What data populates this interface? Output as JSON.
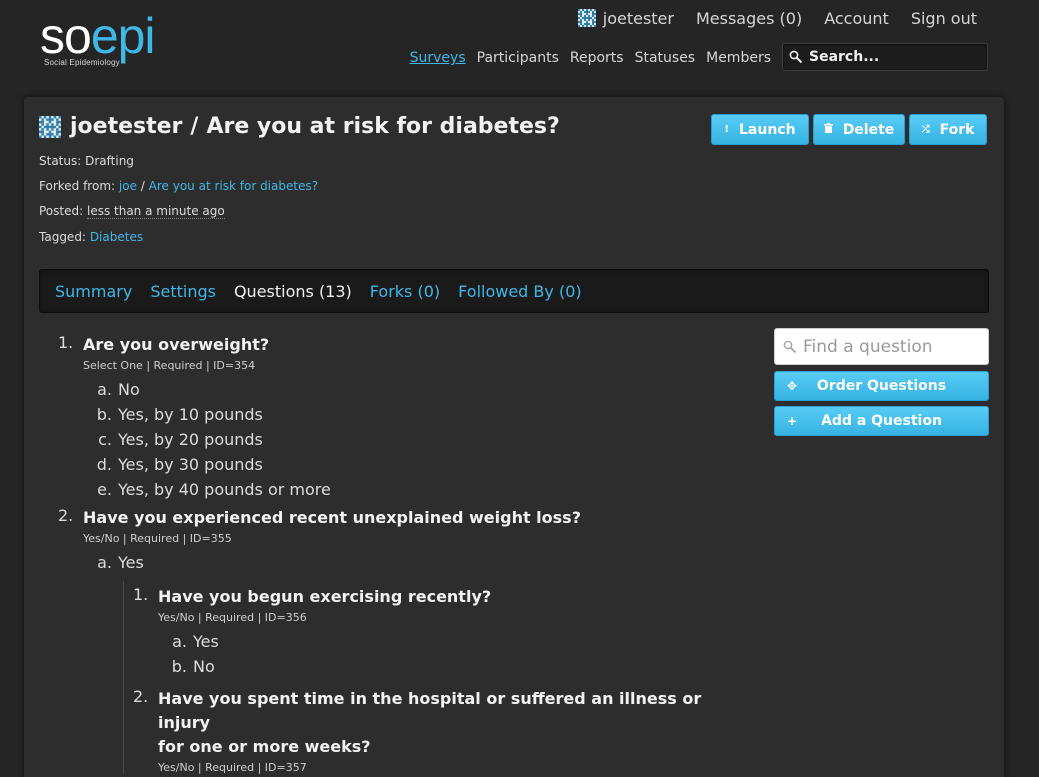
{
  "brand": {
    "logo_so": "so",
    "logo_epi": "epi",
    "tagline": "Social Epidemiology"
  },
  "user_nav": {
    "username": "joetester",
    "messages": "Messages (0)",
    "account": "Account",
    "signout": "Sign out"
  },
  "main_nav": [
    "Surveys",
    "Participants",
    "Reports",
    "Statuses",
    "Members"
  ],
  "search": {
    "placeholder": "Search..."
  },
  "survey": {
    "owner": "joetester",
    "separator": "/",
    "title": "Are you at risk for diabetes?",
    "status_label": "Status:",
    "status": "Drafting",
    "forked_label": "Forked from:",
    "forked_user": "joe",
    "forked_sep": "/",
    "forked_title": "Are you at risk for diabetes?",
    "posted_label": "Posted:",
    "posted": "less than a minute ago",
    "tagged_label": "Tagged:",
    "tag": "Diabetes"
  },
  "actions": {
    "launch": "Launch",
    "delete": "Delete",
    "fork": "Fork"
  },
  "tabs": [
    "Summary",
    "Settings",
    "Questions (13)",
    "Forks (0)",
    "Followed By (0)"
  ],
  "questions": [
    {
      "num": "1.",
      "text": "Are you overweight?",
      "meta": "Select One | Required | ID=354",
      "options": [
        {
          "l": "a.",
          "t": "No"
        },
        {
          "l": "b.",
          "t": "Yes, by 10 pounds"
        },
        {
          "l": "c.",
          "t": "Yes, by 20 pounds"
        },
        {
          "l": "d.",
          "t": "Yes, by 30 pounds"
        },
        {
          "l": "e.",
          "t": "Yes, by 40 pounds or more"
        }
      ]
    },
    {
      "num": "2.",
      "text": "Have you experienced recent unexplained weight loss?",
      "meta": "Yes/No | Required | ID=355",
      "options": [
        {
          "l": "a.",
          "t": "Yes"
        }
      ],
      "sub": [
        {
          "num": "1.",
          "text": "Have you begun exercising recently?",
          "meta": "Yes/No | Required | ID=356",
          "options": [
            {
              "l": "a.",
              "t": "Yes"
            },
            {
              "l": "b.",
              "t": "No"
            }
          ]
        },
        {
          "num": "2.",
          "text": "Have you spent time in the hospital or suffered an illness or injury",
          "text2": "for one or more weeks?",
          "meta": "Yes/No | Required | ID=357"
        }
      ]
    }
  ],
  "side": {
    "find_placeholder": "Find a question",
    "order": "Order Questions",
    "add": "Add a Question"
  },
  "colors": {
    "accent": "#3fb8e8",
    "background": "#252525",
    "panel": "#2d2d2d"
  },
  "icons": {
    "avatar": "identicon",
    "search": "magnifier-icon",
    "launch": "exclamation-icon",
    "delete": "trash-icon",
    "fork": "shuffle-icon",
    "order": "move-icon",
    "add": "plus-icon"
  }
}
